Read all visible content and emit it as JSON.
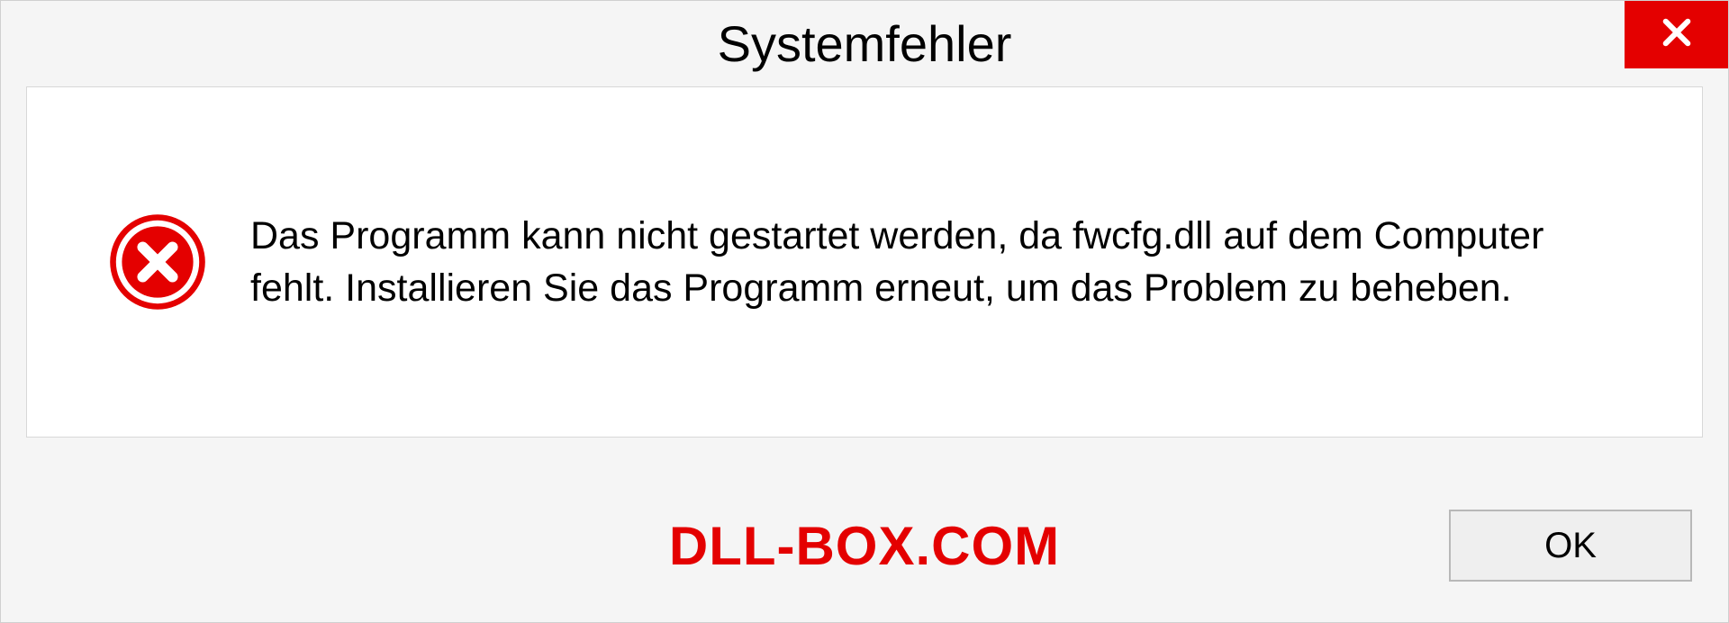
{
  "dialog": {
    "title": "Systemfehler",
    "message": "Das Programm kann nicht gestartet werden, da fwcfg.dll auf dem Computer fehlt. Installieren Sie das Programm erneut, um das Problem zu beheben.",
    "ok_label": "OK"
  },
  "watermark": "DLL-BOX.COM",
  "colors": {
    "close_button_bg": "#e40000",
    "error_icon_fill": "#e40000",
    "watermark_color": "#e40000"
  }
}
